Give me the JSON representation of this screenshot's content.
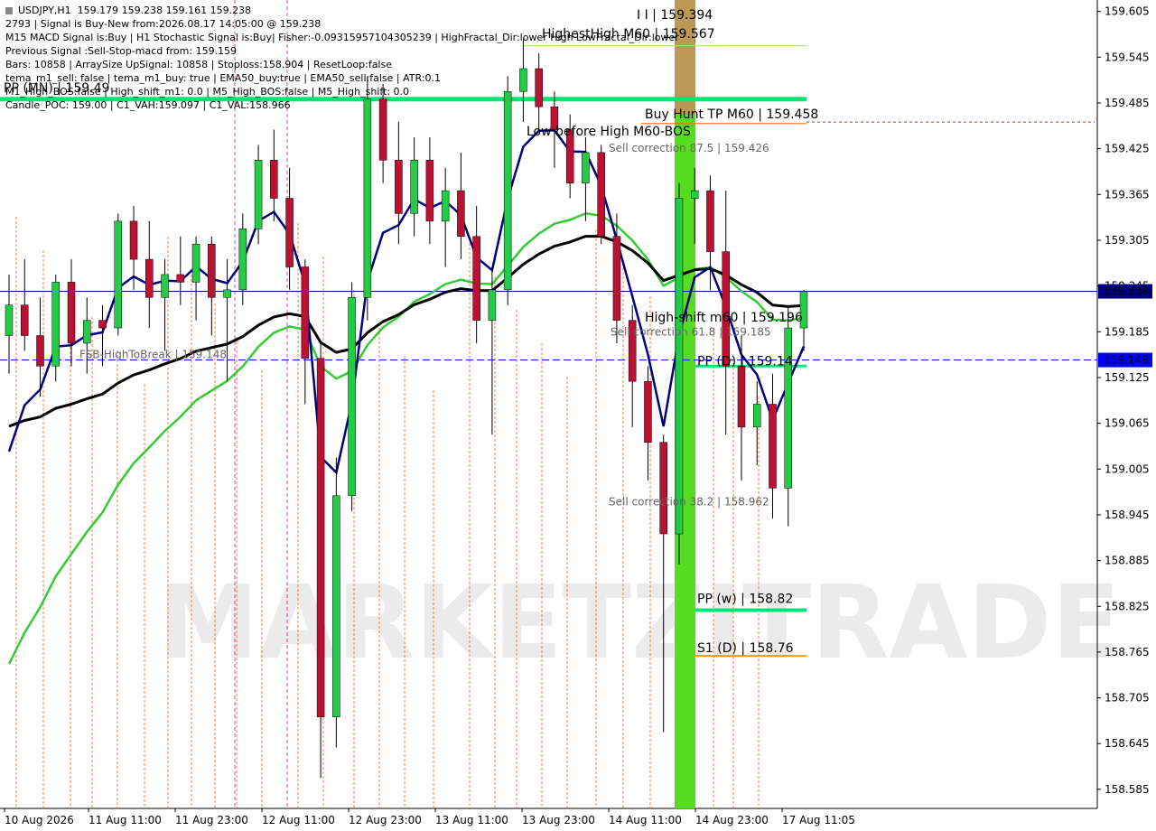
{
  "chart_data": {
    "type": "candlestick",
    "symbol": "USDJPY,H1",
    "ohlc_text": "159.179 159.238 159.161 159.238",
    "info_lines": [
      "2793 | Signal is Buy-New from:2026.08.17 14:05:00 @ 159.238",
      "M15 MACD Signal is:Buy | H1 Stochastic Signal is:Buy| Fisher:-0.09315957104305239 | HighFractal_Dir:lower High   LowFractal_Dir:lower",
      "Previous Signal :Sell-Stop-macd from: 159.159",
      "Bars: 10858 | ArraySize UpSignal: 10858 | Stoploss:158.904 | ResetLoop:false",
      "tema_m1_sell: false | tema_m1_buy: true | EMA50_buy:true | EMA50_sell:false | ATR:0.1",
      "M1_High_BOS:false | High_shift_m1: 0.0 | M5_High_BOS:false | M5_High_shift: 0.0",
      "Candle_POC: 159.00 | C1_VAH:159.097 | C1_VAL:158.966"
    ],
    "y_axis": {
      "ticks": [
        "159.605",
        "159.545",
        "159.485",
        "159.425",
        "159.365",
        "159.305",
        "159.245",
        "159.185",
        "159.125",
        "159.065",
        "159.005",
        "158.945",
        "158.885",
        "158.825",
        "158.765",
        "158.705",
        "158.645",
        "158.585"
      ],
      "min": 158.56,
      "max": 159.62
    },
    "x_axis": {
      "ticks": [
        "10 Aug 2026",
        "11 Aug 11:00",
        "11 Aug 23:00",
        "12 Aug 11:00",
        "12 Aug 23:00",
        "13 Aug 11:00",
        "13 Aug 23:00",
        "14 Aug 11:00",
        "14 Aug 23:00",
        "17 Aug 11:05"
      ]
    },
    "current_price": {
      "label": "159.238",
      "value": 159.238,
      "color": "#000080"
    },
    "dashed_price": {
      "label": "159.148",
      "value": 159.148,
      "color": "#0000ff"
    },
    "levels": [
      {
        "label": "PP (MN) | 159.49",
        "value": 159.49,
        "color": "#00e676"
      },
      {
        "label": "Buy Hunt TP M60 | 159.458",
        "value": 159.458,
        "color": "#ff6600"
      },
      {
        "label": "Low before High   M60-BOS",
        "value": 159.44,
        "color": "#000000"
      },
      {
        "label": "High-shift m60 | 159.196",
        "value": 159.196,
        "color": "#000000"
      },
      {
        "label": "PP (D) | 159.14",
        "value": 159.14,
        "color": "#00e676"
      },
      {
        "label": "PP (w) | 158.82",
        "value": 158.82,
        "color": "#00e676"
      },
      {
        "label": "S1 (D) | 158.76",
        "value": 158.76,
        "color": "#ff9900"
      },
      {
        "label": "FSB-HighToBreak | 159.148",
        "value": 159.148,
        "color": "#000000"
      }
    ],
    "annotations": [
      {
        "text": "I I | 159.394",
        "value": 159.58
      },
      {
        "text": "HighestHigh  M60 | 159.567",
        "value": 159.567
      },
      {
        "text": "Sell correction 87.5 | 159.426",
        "value": 159.426
      },
      {
        "text": "Sell correction 61.8 | 159.185",
        "value": 159.185
      },
      {
        "text": "Sell correction 38.2 | 158.962",
        "value": 158.962
      }
    ],
    "watermark": "MARKETZITRADE",
    "candles": [
      [
        159.18,
        159.26,
        159.13,
        159.22
      ],
      [
        159.22,
        159.28,
        159.16,
        159.18
      ],
      [
        159.18,
        159.23,
        159.1,
        159.14
      ],
      [
        159.14,
        159.26,
        159.12,
        159.25
      ],
      [
        159.25,
        159.28,
        159.14,
        159.17
      ],
      [
        159.17,
        159.23,
        159.13,
        159.2
      ],
      [
        159.2,
        159.22,
        159.14,
        159.19
      ],
      [
        159.19,
        159.34,
        159.18,
        159.33
      ],
      [
        159.33,
        159.35,
        159.24,
        159.28
      ],
      [
        159.28,
        159.33,
        159.19,
        159.23
      ],
      [
        159.23,
        159.28,
        159.16,
        159.26
      ],
      [
        159.26,
        159.31,
        159.22,
        159.25
      ],
      [
        159.25,
        159.31,
        159.2,
        159.3
      ],
      [
        159.3,
        159.31,
        159.18,
        159.23
      ],
      [
        159.23,
        159.28,
        159.12,
        159.24
      ],
      [
        159.24,
        159.34,
        159.22,
        159.32
      ],
      [
        159.32,
        159.43,
        159.3,
        159.41
      ],
      [
        159.41,
        159.45,
        159.33,
        159.36
      ],
      [
        159.36,
        159.4,
        159.24,
        159.27
      ],
      [
        159.27,
        159.28,
        159.09,
        159.15
      ],
      [
        159.15,
        159.17,
        158.6,
        158.68
      ],
      [
        158.68,
        159.02,
        158.64,
        158.97
      ],
      [
        158.97,
        159.25,
        158.95,
        159.23
      ],
      [
        159.23,
        159.52,
        159.2,
        159.49
      ],
      [
        159.49,
        159.51,
        159.38,
        159.41
      ],
      [
        159.41,
        159.46,
        159.3,
        159.34
      ],
      [
        159.34,
        159.44,
        159.31,
        159.41
      ],
      [
        159.41,
        159.44,
        159.3,
        159.33
      ],
      [
        159.33,
        159.4,
        159.27,
        159.37
      ],
      [
        159.37,
        159.42,
        159.28,
        159.31
      ],
      [
        159.31,
        159.35,
        159.17,
        159.2
      ],
      [
        159.2,
        159.27,
        159.05,
        159.24
      ],
      [
        159.24,
        159.52,
        159.22,
        159.5
      ],
      [
        159.5,
        159.57,
        159.46,
        159.53
      ],
      [
        159.53,
        159.55,
        159.45,
        159.48
      ],
      [
        159.48,
        159.5,
        159.4,
        159.45
      ],
      [
        159.45,
        159.47,
        159.36,
        159.38
      ],
      [
        159.38,
        159.44,
        159.33,
        159.42
      ],
      [
        159.42,
        159.43,
        159.3,
        159.31
      ],
      [
        159.31,
        159.34,
        159.17,
        159.2
      ],
      [
        159.2,
        159.22,
        159.06,
        159.12
      ],
      [
        159.12,
        159.14,
        158.99,
        159.04
      ],
      [
        159.04,
        159.05,
        158.66,
        158.92
      ],
      [
        158.92,
        159.38,
        158.88,
        159.36
      ],
      [
        159.36,
        159.4,
        159.3,
        159.37
      ],
      [
        159.37,
        159.39,
        159.24,
        159.29
      ],
      [
        159.29,
        159.37,
        159.05,
        159.14
      ],
      [
        159.14,
        159.18,
        158.99,
        159.06
      ],
      [
        159.06,
        159.12,
        159.01,
        159.09
      ],
      [
        159.09,
        159.13,
        158.94,
        158.98
      ],
      [
        158.98,
        159.22,
        158.93,
        159.19
      ],
      [
        159.19,
        159.24,
        159.16,
        159.238
      ]
    ]
  }
}
